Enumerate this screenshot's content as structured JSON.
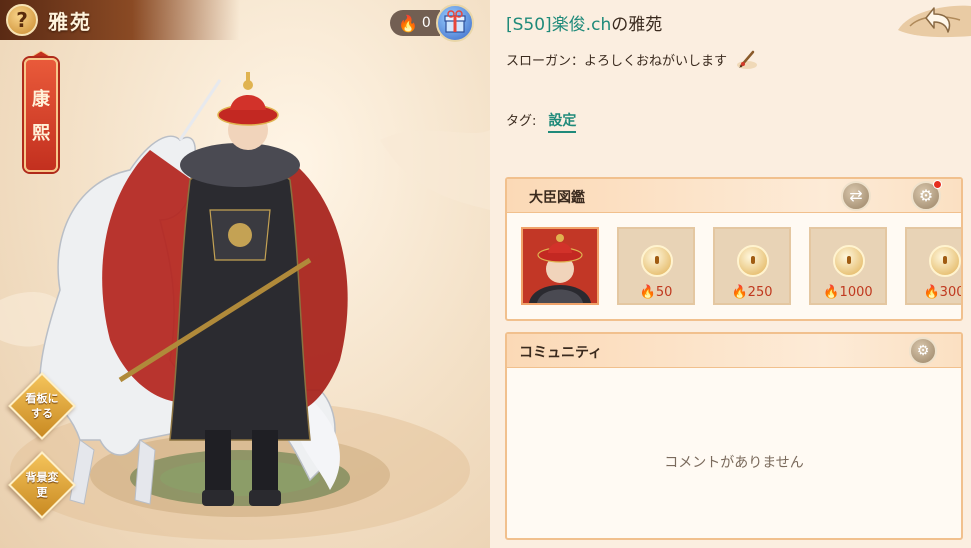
{
  "header": {
    "title": "雅苑",
    "help_symbol": "?"
  },
  "fire_counter": {
    "value": "0"
  },
  "character": {
    "name_chars": [
      "康",
      "熙"
    ]
  },
  "side_buttons": {
    "signboard_label": "看板にする",
    "background_label": "背景変更"
  },
  "profile": {
    "owner_name": "[S50]楽俊.ch",
    "owner_suffix": "の雅苑",
    "slogan": "スローガン：よろしくおねがいします",
    "tag_label": "タグ:",
    "tag_action": "設定"
  },
  "minister_book": {
    "title": "大臣図鑑",
    "slots": [
      {
        "state": "unlocked",
        "cost": ""
      },
      {
        "state": "locked",
        "cost": "50"
      },
      {
        "state": "locked",
        "cost": "250"
      },
      {
        "state": "locked",
        "cost": "1000"
      },
      {
        "state": "locked",
        "cost": "300"
      }
    ]
  },
  "community": {
    "title": "コミュニティ",
    "empty_message": "コメントがありません"
  },
  "colors": {
    "accent_teal": "#1f8a7a",
    "banner_red": "#c3301f",
    "card_border": "#f1c08d"
  }
}
